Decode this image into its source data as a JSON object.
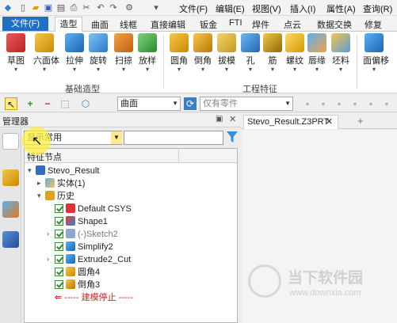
{
  "menubar": [
    "文件(F)",
    "编辑(E)",
    "视图(V)",
    "插入(I)",
    "属性(A)",
    "查询(R)"
  ],
  "ribbon_tabs": [
    "文件(F)",
    "造型",
    "曲面",
    "线框",
    "直接编辑",
    "钣金",
    "FTI",
    "焊件",
    "点云",
    "数据交换",
    "修复"
  ],
  "ribbon": {
    "basic_buttons": [
      "草图",
      "六面体",
      "拉伸",
      "旋转",
      "扫掠",
      "放样"
    ],
    "basic_group_label": "基础造型",
    "feature_buttons": [
      "圆角",
      "倒角",
      "拔模",
      "孔",
      "筋",
      "螺纹",
      "唇缘",
      "坯料"
    ],
    "feature_group_label": "工程特征",
    "extra_buttons": [
      "面偏移"
    ]
  },
  "toolbar": {
    "surface_combo": "曲面",
    "filter_combo": "仅有零件"
  },
  "manager": {
    "title": "管理器",
    "filter_value": "显示常用",
    "tree_header": "特征节点",
    "tree": {
      "root": "Stevo_Result",
      "solid": "实体(1)",
      "history": "历史",
      "items": [
        "Default CSYS",
        "Shape1",
        "(-)Sketch2",
        "Simplify2",
        "Extrude2_Cut",
        "圆角4",
        "倒角3"
      ],
      "stop": "----- 建模停止 -----"
    }
  },
  "document": {
    "tab": "Stevo_Result.Z3PRT",
    "watermark_title": "当下软件园",
    "watermark_url": "www.downxia.com"
  },
  "colors": {
    "accent": "#1f6fc5",
    "highlight": "#fff03c",
    "stop_red": "#dd2222"
  }
}
